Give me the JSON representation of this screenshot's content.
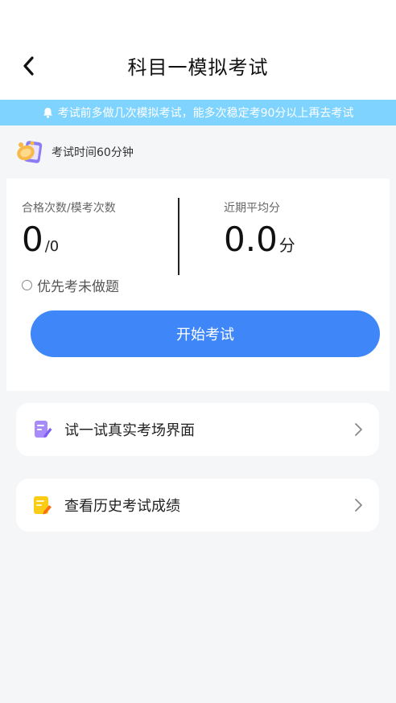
{
  "header": {
    "title": "科目一模拟考试",
    "back_icon": "chevron-left-icon"
  },
  "notice": {
    "text": "考试前多做几次模拟考试，能多次稳定考90分以上再去考试",
    "icon": "bell-icon"
  },
  "exam_time": {
    "text": "考试时间60分钟",
    "icon": "alarm-clock-icon"
  },
  "stats": {
    "pass_label": "合格次数/模考次数",
    "pass_count": "0",
    "exam_count_text": "/0",
    "avg_label": "近期平均分",
    "avg_score": "0.0",
    "avg_unit": "分"
  },
  "options": {
    "priority_label": "优先考未做题"
  },
  "actions": {
    "start_label": "开始考试"
  },
  "menu": [
    {
      "label": "试一试真实考场界面",
      "icon": "exam-pen-icon"
    },
    {
      "label": "查看历史考试成绩",
      "icon": "history-notepad-icon"
    }
  ],
  "colors": {
    "primary": "#3f87f8",
    "notice_bg": "#7fd4ff",
    "page_bg": "#f5f6f8",
    "exam_icon": "#a78bfa",
    "history_icon": "#facc15"
  }
}
